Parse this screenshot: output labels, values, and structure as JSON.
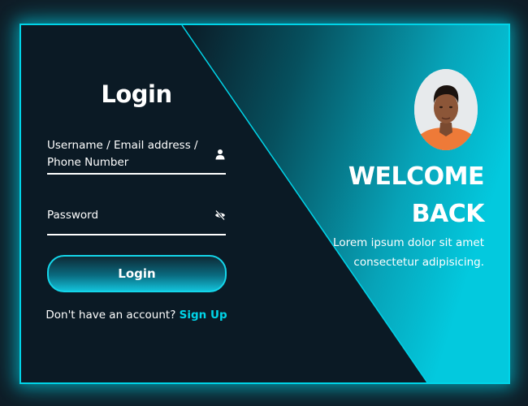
{
  "login": {
    "title": "Login",
    "username_label": "Username / Email address / Phone Number",
    "username_icon": "user-icon",
    "password_label": "Password",
    "password_icon": "eye-slash-icon",
    "button_label": "Login",
    "signup_prompt": "Don't have an account?",
    "signup_link": "Sign Up"
  },
  "welcome": {
    "line1": "WELCOME",
    "line2": "BACK",
    "subtitle": "Lorem ipsum dolor sit amet consectetur adipisicing."
  },
  "colors": {
    "accent": "#00d4e8",
    "background": "#0b1a25",
    "page_background": "#0f1b25"
  }
}
